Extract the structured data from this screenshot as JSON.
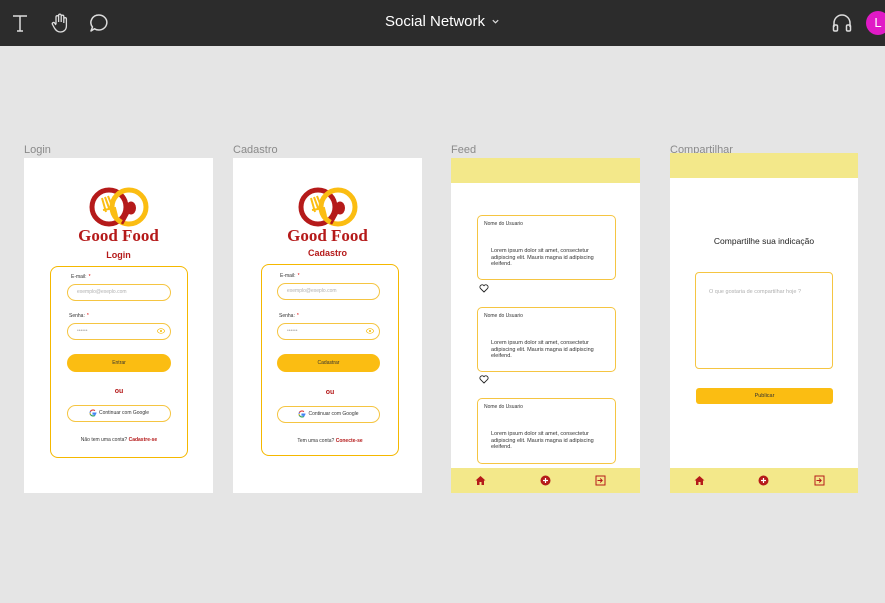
{
  "toolbar": {
    "title": "Social Network",
    "avatar_initial": "L",
    "icons": [
      "text-tool-icon",
      "hand-tool-icon",
      "comment-tool-icon",
      "headphones-icon"
    ]
  },
  "colors": {
    "brand_red": "#b51a1a",
    "brand_yellow": "#fbbd12",
    "bar_yellow": "#f3e88a",
    "avatar_pink": "#e01ac6"
  },
  "login": {
    "frame_label": "Login",
    "brand": "Good Food",
    "title": "Login",
    "email_label": "E-mail:",
    "email_placeholder": "exemplo@exeplo.com",
    "password_label": "Senha:",
    "password_placeholder": "••••••",
    "submit": "Entrar",
    "or": "ou",
    "google": "Continuar com Google",
    "footer_text": "Não tem uma conta?",
    "footer_link": "Cadastre-se"
  },
  "signup": {
    "frame_label": "Cadastro",
    "brand": "Good Food",
    "title": "Cadastro",
    "email_label": "E-mail:",
    "email_placeholder": "exemplo@exeplo.com",
    "password_label": "Senha:",
    "password_placeholder": "••••••",
    "submit": "Cadastrar",
    "or": "ou",
    "google": "Continuar com Google",
    "footer_text": "Tem uma conta?",
    "footer_link": "Conecte-se"
  },
  "feed": {
    "frame_label": "Feed",
    "posts": [
      {
        "user": "Nome do Usuario",
        "text": "Lorem ipsum dolor sit amet, consectetur adipiscing elit. Mauris magna id adipiscing eleifend."
      },
      {
        "user": "Nome do Usuario",
        "text": "Lorem ipsum dolor sit amet, consectetur adipiscing elit. Mauris magna id adipiscing eleifend."
      },
      {
        "user": "Nome do Usuario",
        "text": "Lorem ipsum dolor sit amet, consectetur adipiscing elit. Mauris magna id adipiscing eleifend."
      }
    ]
  },
  "share": {
    "frame_label": "Compartilhar",
    "title": "Compartilhe sua indicação",
    "placeholder": "O que gostaria de compartilhar hoje ?",
    "publish": "Publicar"
  }
}
